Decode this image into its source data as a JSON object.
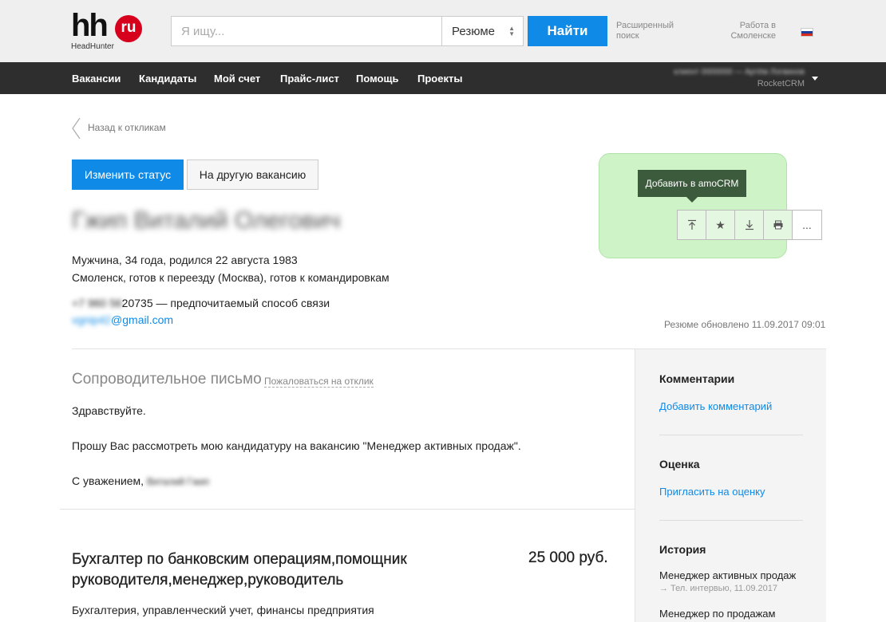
{
  "header": {
    "logo_text": "hh",
    "logo_badge": "ru",
    "logo_sub": "HeadHunter",
    "search_placeholder": "Я ищу...",
    "search_type": "Резюме",
    "find_label": "Найти",
    "advanced_line1": "Расширенный",
    "advanced_line2": "поиск",
    "city_line1": "Работа в",
    "city_line2": "Смоленске"
  },
  "nav": {
    "items": [
      "Вакансии",
      "Кандидаты",
      "Мой счет",
      "Прайс-лист",
      "Помощь",
      "Проекты"
    ],
    "account_name": "клиент 0000000 — Артём Логвинов",
    "account_crm": "RocketCRM"
  },
  "resume": {
    "back_label": "Назад к откликам",
    "change_status": "Изменить статус",
    "other_vacancy": "На другую вакансию",
    "name": "Гжип Виталий Олегович",
    "line1": "Мужчина, 34 года, родился 22 августа 1983",
    "line2": "Смоленск, готов к переезду (Москва), готов к командировкам",
    "phone_hidden": "+7 960 56",
    "phone_visible": "20735 — предпочитаемый способ связи",
    "email_hidden": "vgnip42",
    "email_visible": "@gmail.com",
    "updated": "Резюме обновлено 11.09.2017 09:01",
    "tooltip": "Добавить в amoCRM",
    "tools": [
      "upload-icon",
      "star-icon",
      "download-icon",
      "print-icon",
      "more-icon"
    ],
    "more_label": "..."
  },
  "letter": {
    "title": "Сопроводительное письмо",
    "complain": "Пожаловаться на отклик",
    "greeting": "Здравствуйте.",
    "body": "Прошу Вас рассмотреть мою кандидатуру на вакансию \"Менеджер активных продаж\".",
    "closing": "С уважением,",
    "signature": "Виталий Гжип"
  },
  "position": {
    "title": "Бухгалтер по банковским операциям,помощник руководителя,менеджер,руководитель",
    "salary": "25 000 руб.",
    "specializations": "Бухгалтерия, управленческий учет, финансы предприятия"
  },
  "sidebar": {
    "comments_title": "Комментарии",
    "add_comment": "Добавить комментарий",
    "assessment_title": "Оценка",
    "invite_assessment": "Пригласить на оценку",
    "history_title": "История",
    "history": [
      {
        "title": "Менеджер активных продаж",
        "sub": "→ Тел. интервью, 11.09.2017"
      },
      {
        "title": "Менеджер по продажам",
        "sub": ""
      }
    ]
  },
  "colors": {
    "accent": "#0f8ae6",
    "nav_bg": "#2e2e2e",
    "highlight": "#c9f2c2",
    "tooltip_bg": "#3c5b3c",
    "logo_red": "#d6001c"
  }
}
